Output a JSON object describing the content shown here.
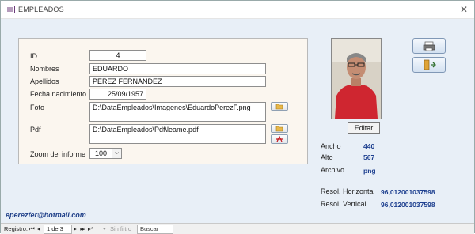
{
  "window": {
    "title": "EMPLEADOS",
    "close_glyph": "✕"
  },
  "form": {
    "id": {
      "label": "ID",
      "value": "4"
    },
    "nombres": {
      "label": "Nombres",
      "value": "EDUARDO"
    },
    "apellidos": {
      "label": "Apellidos",
      "value": "PEREZ FERNANDEZ"
    },
    "fecha": {
      "label": "Fecha nacimiento",
      "value": "25/09/1957"
    },
    "foto": {
      "label": "Foto",
      "value": "D:\\DataEmpleados\\Imagenes\\EduardoPerezF.png"
    },
    "pdf": {
      "label": "Pdf",
      "value": "D:\\DataEmpleados\\Pdf\\leame.pdf"
    },
    "zoom": {
      "label": "Zoom del informe",
      "value": "100"
    }
  },
  "edit_button": {
    "label": "Editar"
  },
  "image_info": {
    "ancho": {
      "label": "Ancho",
      "value": "440"
    },
    "alto": {
      "label": "Alto",
      "value": "567"
    },
    "archivo": {
      "label": "Archivo",
      "value": "png"
    },
    "resol_h": {
      "label": "Resol. Horizontal",
      "value": "96,012001037598"
    },
    "resol_v": {
      "label": "Resol. Vertical",
      "value": "96,012001037598"
    }
  },
  "email": "eperezfer@hotmail.com",
  "navbar": {
    "label": "Registro:",
    "position": "1 de 3",
    "filter": "Sin filtro",
    "search_placeholder": "Buscar"
  },
  "colors": {
    "accent": "#1d3f8f",
    "form_bg": "#fbf6ef",
    "window_bg": "#e8eff7"
  }
}
